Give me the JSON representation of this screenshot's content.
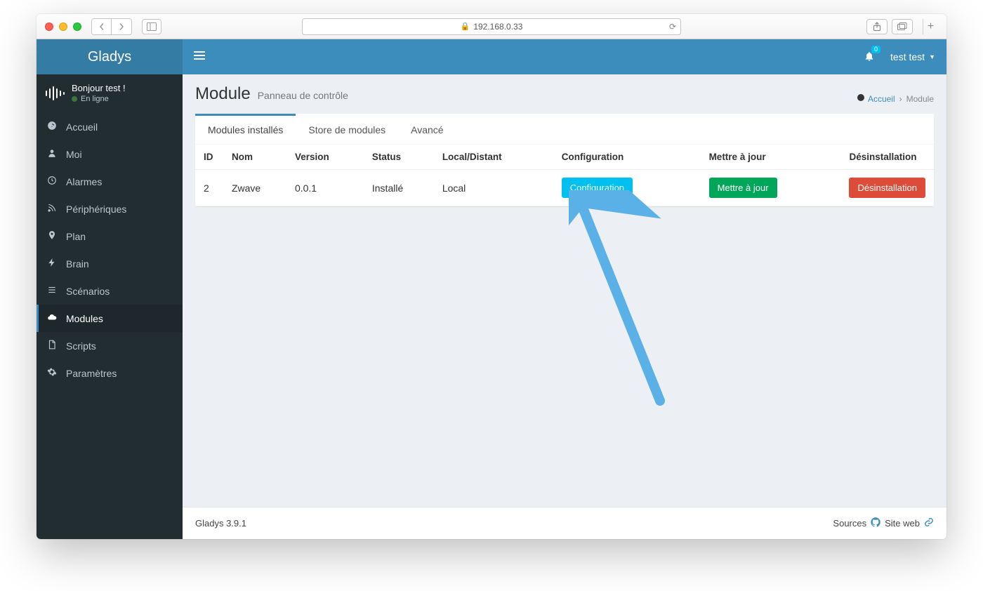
{
  "browser": {
    "url": "192.168.0.33"
  },
  "brand": "Gladys",
  "user_panel": {
    "greeting": "Bonjour test !",
    "status": "En ligne"
  },
  "sidebar": {
    "items": [
      {
        "label": "Accueil"
      },
      {
        "label": "Moi"
      },
      {
        "label": "Alarmes"
      },
      {
        "label": "Périphériques"
      },
      {
        "label": "Plan"
      },
      {
        "label": "Brain"
      },
      {
        "label": "Scénarios"
      },
      {
        "label": "Modules"
      },
      {
        "label": "Scripts"
      },
      {
        "label": "Paramètres"
      }
    ]
  },
  "topbar": {
    "notification_count": "0",
    "user": "test test"
  },
  "page": {
    "title": "Module",
    "subtitle": "Panneau de contrôle"
  },
  "breadcrumb": {
    "home": "Accueil",
    "current": "Module"
  },
  "tabs": {
    "installed": "Modules installés",
    "store": "Store de modules",
    "advanced": "Avancé"
  },
  "table": {
    "headers": {
      "id": "ID",
      "name": "Nom",
      "version": "Version",
      "status": "Status",
      "local": "Local/Distant",
      "config": "Configuration",
      "update": "Mettre à jour",
      "uninstall": "Désinstallation"
    },
    "row": {
      "id": "2",
      "name": "Zwave",
      "version": "0.0.1",
      "status": "Installé",
      "local": "Local",
      "config_btn": "Configuration",
      "update_btn": "Mettre à jour",
      "uninstall_btn": "Désinstallation"
    }
  },
  "footer": {
    "version": "Gladys 3.9.1",
    "sources": "Sources",
    "site": "Site web"
  }
}
